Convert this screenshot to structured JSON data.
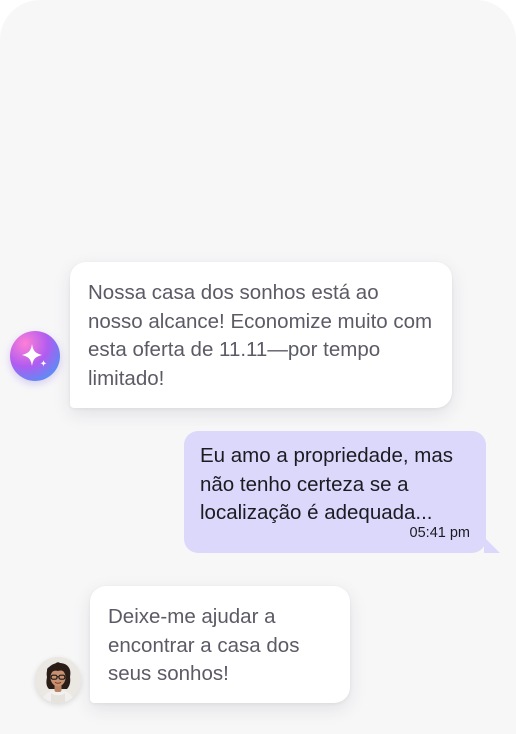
{
  "messages": [
    {
      "sender": "bot",
      "text": "Nossa casa dos sonhos está ao nosso alcance! Economize muito com esta oferta de 11.11—por tempo limitado!"
    },
    {
      "sender": "me",
      "text": "Eu amo a propriedade, mas não tenho certeza se a localização é adequada...",
      "time": "05:41 pm"
    },
    {
      "sender": "agent",
      "text": "Deixe-me ajudar a encontrar a casa dos seus sonhos!"
    }
  ],
  "icons": {
    "bot_avatar": "sparkle-icon",
    "user_avatar": "person-avatar"
  },
  "colors": {
    "background": "#f7f7f8",
    "incoming_bubble": "#ffffff",
    "outgoing_bubble": "#dcd8fb",
    "incoming_text": "#5b5b66",
    "outgoing_text": "#1b1b22"
  }
}
